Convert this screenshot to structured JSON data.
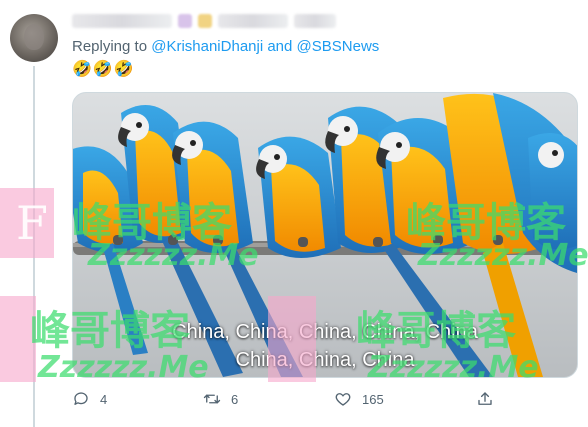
{
  "tweet": {
    "replying_prefix": "Replying to ",
    "mention_1": "@KrishaniDhanji",
    "conjunction": " and ",
    "mention_2": "@SBSNews",
    "text": "🤣🤣🤣",
    "caption_line_1": "China, China, China, China, China",
    "caption_line_2": "China, China, China"
  },
  "actions": {
    "reply_count": "4",
    "retweet_count": "6",
    "like_count": "165"
  },
  "watermark": {
    "text": "峰哥博客",
    "url": "Zzzzzz.Me",
    "letter": "F"
  },
  "colors": {
    "link": "#1d9bf0",
    "muted": "#536471",
    "watermark_green": "#3cdc6e",
    "watermark_pink": "#f6a6cc"
  }
}
